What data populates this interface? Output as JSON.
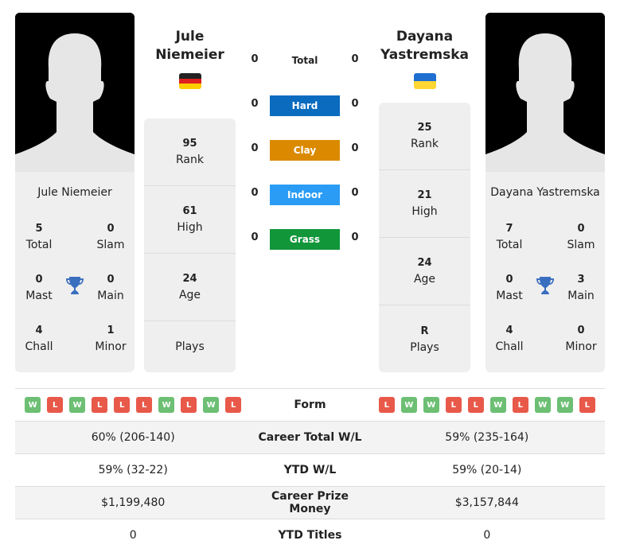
{
  "player1": {
    "name_line1": "Jule",
    "name_line2": "Niemeier",
    "full_name": "Jule Niemeier",
    "country_flag": "germany-flag",
    "flag_colors": [
      "#222222",
      "#dd1f1f",
      "#ffce00"
    ],
    "titles": {
      "total": {
        "value": "5",
        "label": "Total"
      },
      "slam": {
        "value": "0",
        "label": "Slam"
      },
      "mast": {
        "value": "0",
        "label": "Mast"
      },
      "main": {
        "value": "0",
        "label": "Main"
      },
      "chall": {
        "value": "4",
        "label": "Chall"
      },
      "minor": {
        "value": "1",
        "label": "Minor"
      }
    },
    "stats": [
      {
        "value": "95",
        "label": "Rank"
      },
      {
        "value": "61",
        "label": "High"
      },
      {
        "value": "24",
        "label": "Age"
      },
      {
        "value": "",
        "label": "Plays"
      }
    ],
    "form": [
      "W",
      "L",
      "W",
      "L",
      "L",
      "L",
      "W",
      "L",
      "W",
      "L"
    ]
  },
  "player2": {
    "name_line1": "Dayana",
    "name_line2": "Yastremska",
    "full_name": "Dayana Yastremska",
    "country_flag": "ukraine-flag",
    "flag_colors": [
      "#1f6fd0",
      "#ffd633"
    ],
    "titles": {
      "total": {
        "value": "7",
        "label": "Total"
      },
      "slam": {
        "value": "0",
        "label": "Slam"
      },
      "mast": {
        "value": "0",
        "label": "Mast"
      },
      "main": {
        "value": "3",
        "label": "Main"
      },
      "chall": {
        "value": "4",
        "label": "Chall"
      },
      "minor": {
        "value": "0",
        "label": "Minor"
      }
    },
    "stats": [
      {
        "value": "25",
        "label": "Rank"
      },
      {
        "value": "21",
        "label": "High"
      },
      {
        "value": "24",
        "label": "Age"
      },
      {
        "value": "R",
        "label": "Plays"
      }
    ],
    "form": [
      "L",
      "W",
      "W",
      "L",
      "L",
      "W",
      "L",
      "W",
      "W",
      "L"
    ]
  },
  "h2h": [
    {
      "surface": "Total",
      "p1": "0",
      "p2": "0",
      "color": null
    },
    {
      "surface": "Hard",
      "p1": "0",
      "p2": "0",
      "color": "#0a6bbf"
    },
    {
      "surface": "Clay",
      "p1": "0",
      "p2": "0",
      "color": "#db8a00"
    },
    {
      "surface": "Indoor",
      "p1": "0",
      "p2": "0",
      "color": "#2a9cf5"
    },
    {
      "surface": "Grass",
      "p1": "0",
      "p2": "0",
      "color": "#11963a"
    }
  ],
  "comparison": {
    "form_label": "Form",
    "rows": [
      {
        "label": "Career Total W/L",
        "p1": "60% (206-140)",
        "p2": "59% (235-164)"
      },
      {
        "label": "YTD W/L",
        "p1": "59% (32-22)",
        "p2": "59% (20-14)"
      },
      {
        "label": "Career Prize Money",
        "p1": "$1,199,480",
        "p2": "$3,157,844"
      },
      {
        "label": "YTD Titles",
        "p1": "0",
        "p2": "0"
      }
    ]
  },
  "colors": {
    "trophy": "#3a6fbf",
    "win": "#6cbf73",
    "loss": "#e8594a"
  }
}
